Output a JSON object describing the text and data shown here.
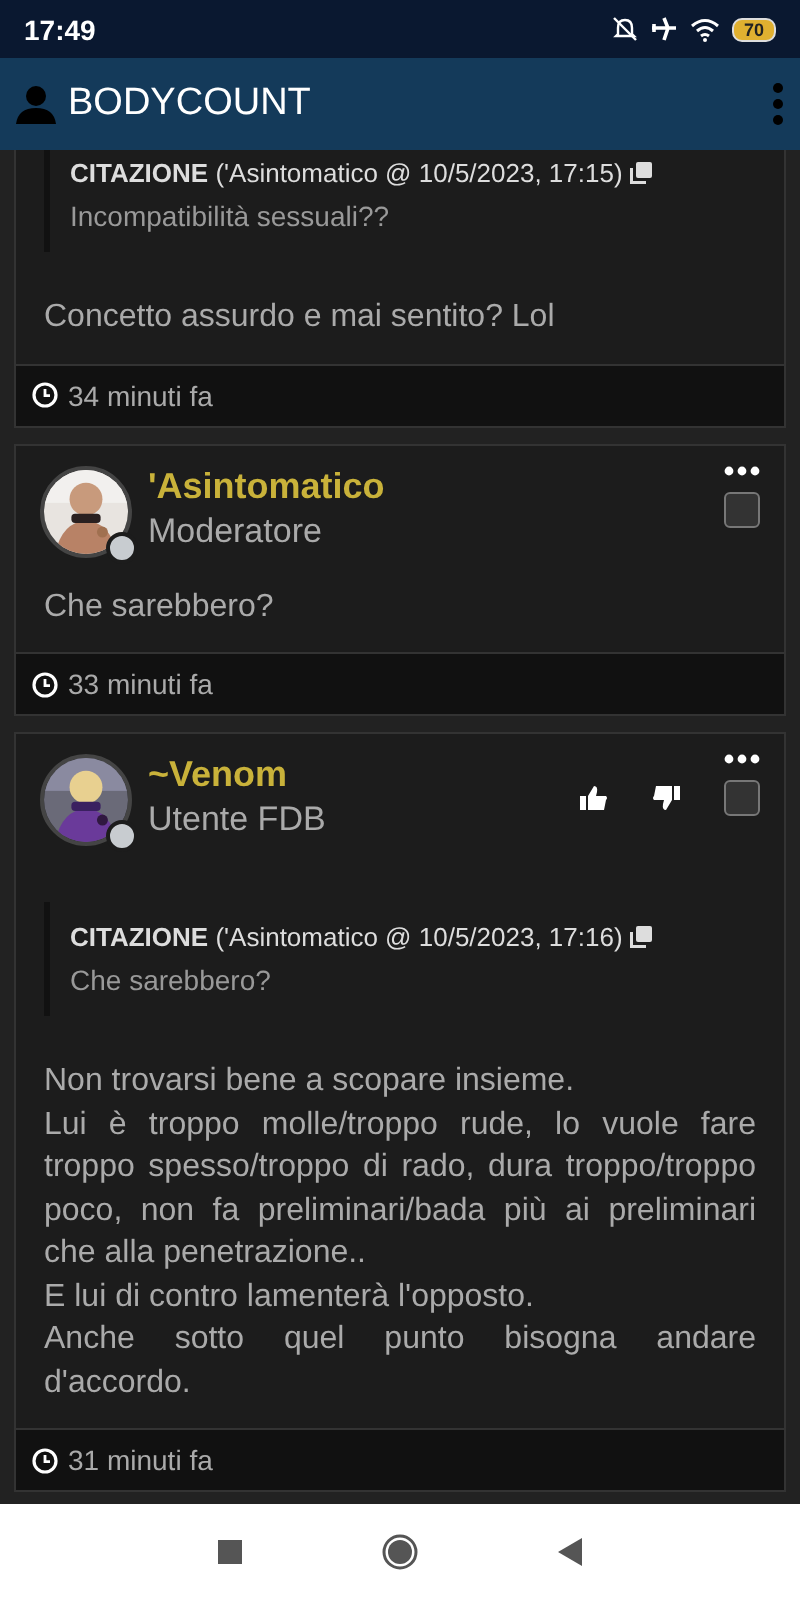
{
  "status_bar": {
    "time": "17:49",
    "battery": "70"
  },
  "app_bar": {
    "title": "BODYCOUNT"
  },
  "posts": [
    {
      "quote": {
        "label": "CITAZIONE",
        "source": "('Asintomatico @ 10/5/2023, 17:15)",
        "text": "Incompatibilità sessuali??"
      },
      "body": [
        "Concetto assurdo e mai sentito? Lol"
      ],
      "time": "34 minuti fa"
    },
    {
      "header": {
        "author": "'Asintomatico",
        "role": "Moderatore",
        "online": false,
        "votes": false,
        "checked": false
      },
      "body": [
        "Che sarebbero?"
      ],
      "time": "33 minuti fa"
    },
    {
      "header": {
        "author": "~Venom",
        "role": "Utente FDB",
        "online": false,
        "votes": true,
        "checked": false
      },
      "quote": {
        "label": "CITAZIONE",
        "source": "('Asintomatico @ 10/5/2023, 17:16)",
        "text": "Che sarebbero?"
      },
      "body": [
        "Non trovarsi bene a scopare insieme.",
        "Lui è troppo molle/troppo rude, lo vuole fare troppo spesso/troppo di rado, dura troppo/troppo poco, non fa preliminari/bada più ai preliminari che alla penetrazione..",
        "E lui di contro lamenterà l'opposto.",
        "Anche sotto quel punto bisogna andare d'accordo."
      ],
      "time": "31 minuti fa"
    }
  ]
}
